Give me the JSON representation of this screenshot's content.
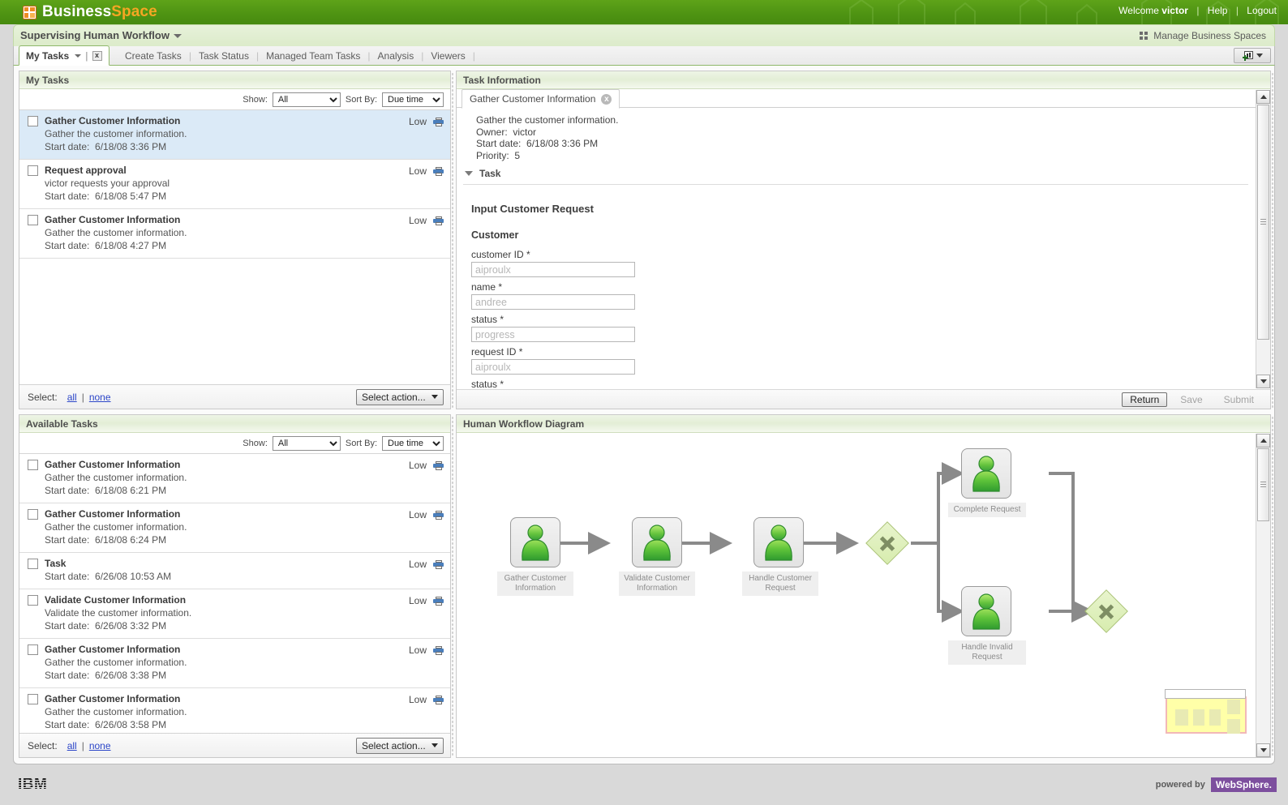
{
  "banner": {
    "product_first": "Business",
    "product_second": "Space",
    "welcome": "Welcome",
    "user": "victor",
    "help": "Help",
    "logout": "Logout",
    "sep": "|"
  },
  "space": {
    "title": "Supervising Human Workflow",
    "manage": "Manage Business Spaces"
  },
  "tabs": {
    "active": "My Tasks",
    "close": "x",
    "pipe": "|",
    "others": [
      "Create Tasks",
      "Task Status",
      "Managed Team Tasks",
      "Analysis",
      "Viewers"
    ]
  },
  "my_tasks": {
    "header": "My Tasks",
    "show_label": "Show:",
    "show_value": "All",
    "show_options": [
      "All"
    ],
    "sort_label": "Sort By:",
    "sort_value": "Due time",
    "sort_options": [
      "Due time"
    ],
    "select_label": "Select:",
    "select_all": "all",
    "select_sep": "|",
    "select_none": "none",
    "action_label": "Select action...",
    "rows": [
      {
        "title": "Gather Customer Information",
        "desc": "Gather the customer information.",
        "date_label": "Start date:",
        "date": "6/18/08 3:36 PM",
        "priority": "Low",
        "selected": true
      },
      {
        "title": "Request approval",
        "desc": "victor requests your approval",
        "date_label": "Start date:",
        "date": "6/18/08 5:47 PM",
        "priority": "Low",
        "selected": false
      },
      {
        "title": "Gather Customer Information",
        "desc": "Gather the customer information.",
        "date_label": "Start date:",
        "date": "6/18/08 4:27 PM",
        "priority": "Low",
        "selected": false
      }
    ]
  },
  "available_tasks": {
    "header": "Available Tasks",
    "show_label": "Show:",
    "show_value": "All",
    "sort_label": "Sort By:",
    "sort_value": "Due time",
    "select_label": "Select:",
    "select_all": "all",
    "select_sep": "|",
    "select_none": "none",
    "action_label": "Select action...",
    "rows": [
      {
        "title": "Gather Customer Information",
        "desc": "Gather the customer information.",
        "date_label": "Start date:",
        "date": "6/18/08 6:21 PM",
        "priority": "Low"
      },
      {
        "title": "Gather Customer Information",
        "desc": "Gather the customer information.",
        "date_label": "Start date:",
        "date": "6/18/08 6:24 PM",
        "priority": "Low"
      },
      {
        "title": "Task",
        "desc": "",
        "date_label": "Start date:",
        "date": "6/26/08 10:53 AM",
        "priority": "Low"
      },
      {
        "title": "Validate Customer Information",
        "desc": "Validate the customer information.",
        "date_label": "Start date:",
        "date": "6/26/08 3:32 PM",
        "priority": "Low"
      },
      {
        "title": "Gather Customer Information",
        "desc": "Gather the customer information.",
        "date_label": "Start date:",
        "date": "6/26/08 3:38 PM",
        "priority": "Low"
      },
      {
        "title": "Gather Customer Information",
        "desc": "Gather the customer information.",
        "date_label": "Start date:",
        "date": "6/26/08 3:58 PM",
        "priority": "Low"
      }
    ]
  },
  "task_information": {
    "header": "Task Information",
    "tab_label": "Gather Customer Information",
    "tab_close": "x",
    "description": "Gather the customer information.",
    "owner_label": "Owner:",
    "owner": "victor",
    "start_label": "Start date:",
    "start": "6/18/08 3:36 PM",
    "priority_label": "Priority:",
    "priority": "5",
    "section_title": "Task",
    "form_title": "Input Customer Request",
    "form_subtitle": "Customer",
    "fields": [
      {
        "label": "customer ID *",
        "placeholder": "aiproulx",
        "value": ""
      },
      {
        "label": "name *",
        "placeholder": "andree",
        "value": ""
      },
      {
        "label": "status *",
        "placeholder": "progress",
        "value": ""
      },
      {
        "label": "request ID *",
        "placeholder": "aiproulx",
        "value": ""
      }
    ],
    "trailing_label": "status *",
    "buttons": {
      "return": "Return",
      "save": "Save",
      "submit": "Submit"
    }
  },
  "diagram": {
    "header": "Human Workflow Diagram",
    "nodes": [
      {
        "label": "Gather Customer Information"
      },
      {
        "label": "Validate Customer Information"
      },
      {
        "label": "Handle Customer Request"
      },
      {
        "label": "Complete Request"
      },
      {
        "label": "Handle Invalid Request"
      }
    ]
  },
  "footer": {
    "ibm": "IBM",
    "powered_by": "powered by",
    "websphere": "WebSphere."
  }
}
